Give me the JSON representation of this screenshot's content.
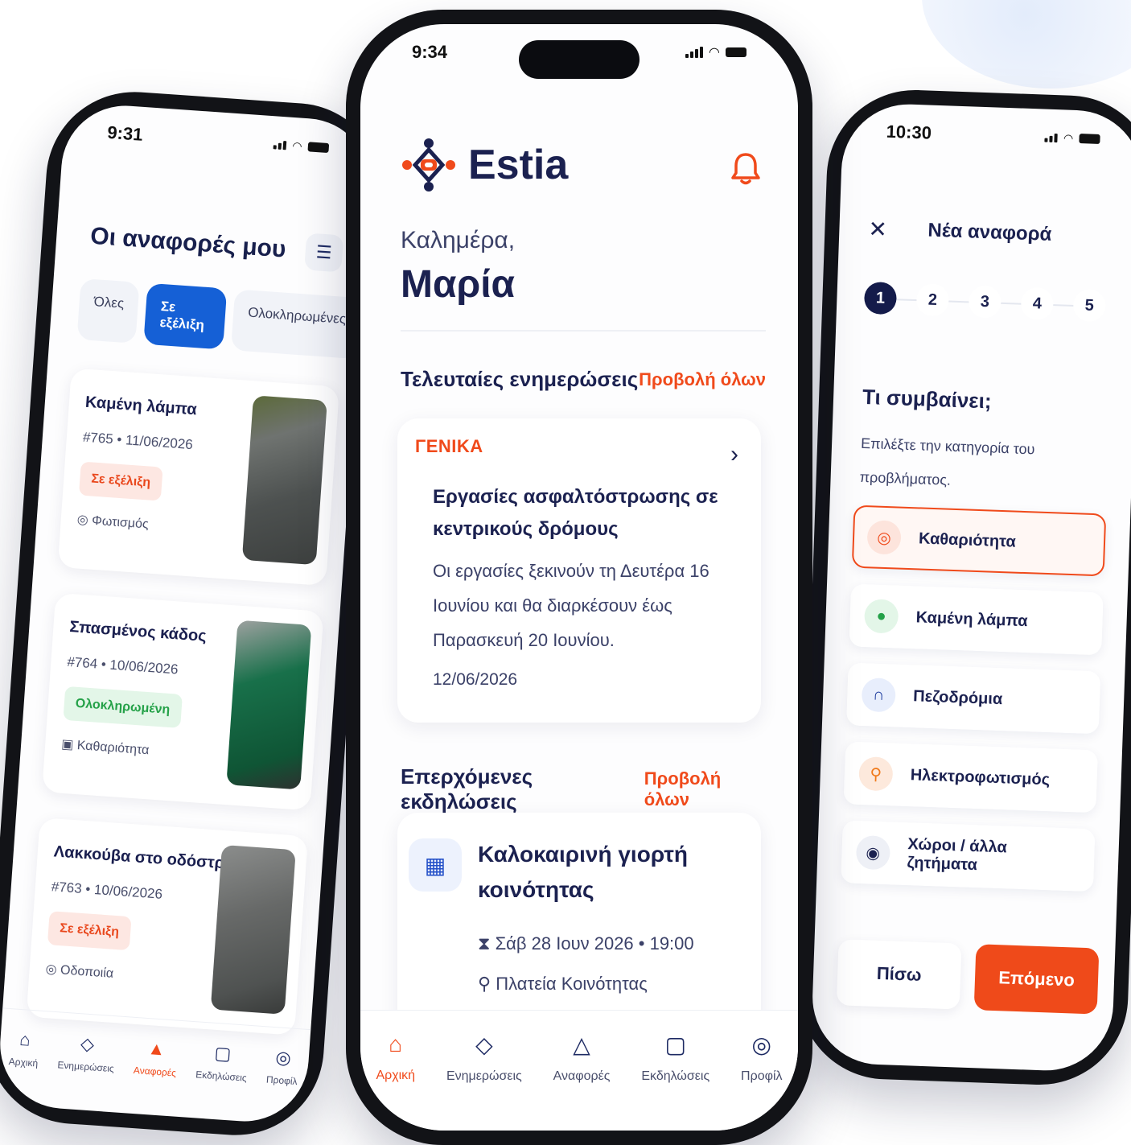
{
  "colors": {
    "accent": "#f04a1b",
    "navy": "#1b2150",
    "blue": "#1560d6",
    "green": "#24a148"
  },
  "left_phone": {
    "time": "9:31",
    "title": "Οι αναφορές μου",
    "filters": [
      "Όλες",
      "Σε εξέλιξη",
      "Ολοκληρωμένες"
    ],
    "reports": [
      {
        "title": "Καμένη λάμπα",
        "meta": "#765 • 11/06/2026",
        "status": "Σε εξέλιξη",
        "category": "Φωτισμός"
      },
      {
        "title": "Σπασμένος κάδος",
        "meta": "#764 • 10/06/2026",
        "status": "Ολοκληρωμένη",
        "category": "Καθαριότητα"
      },
      {
        "title": "Λακκούβα στο οδόστρωμα",
        "meta": "#763 • 10/06/2026",
        "status": "Σε εξέλιξη",
        "category": "Οδοποιία"
      }
    ],
    "nav": [
      "Αρχική",
      "Ενημερώσεις",
      "Αναφορές",
      "Εκδηλώσεις",
      "Προφίλ"
    ]
  },
  "center_phone": {
    "time": "9:34",
    "brand": "Estia",
    "greeting": "Καλημέρα,",
    "name": "Μαρία",
    "updates_title": "Τελευταίες ενημερώσεις",
    "view_all": "Προβολή όλων",
    "news": {
      "category": "ΓΕΝΙΚΑ",
      "title": "Εργασίες ασφαλτόστρωσης σε κεντρικούς δρόμους",
      "body": "Οι εργασίες ξεκινούν τη Δευτέρα 16 Ιουνίου και θα διαρκέσουν έως Παρασκευή 20 Ιουνίου.",
      "date": "12/06/2026"
    },
    "events_title": "Επερχόμενες εκδηλώσεις",
    "event": {
      "title": "Καλοκαιρινή γιορτή κοινότητας",
      "time": "Σάβ 28 Ιουν 2026 • 19:00",
      "place": "Πλατεία Κοινότητας"
    },
    "nav": [
      "Αρχική",
      "Ενημερώσεις",
      "Αναφορές",
      "Εκδηλώσεις",
      "Προφίλ"
    ]
  },
  "right_phone": {
    "time": "10:30",
    "title": "Νέα αναφορά",
    "steps": [
      "1",
      "2",
      "3",
      "4",
      "5"
    ],
    "question": "Τι συμβαίνει;",
    "subtitle": "Επιλέξτε την κατηγορία του προβλήματος.",
    "options": [
      "Καθαριότητα",
      "Καμένη λάμπα",
      "Πεζοδρόμια",
      "Ηλεκτροφωτισμός",
      "Χώροι / άλλα ζητήματα"
    ],
    "back": "Πίσω",
    "next": "Επόμενο"
  }
}
